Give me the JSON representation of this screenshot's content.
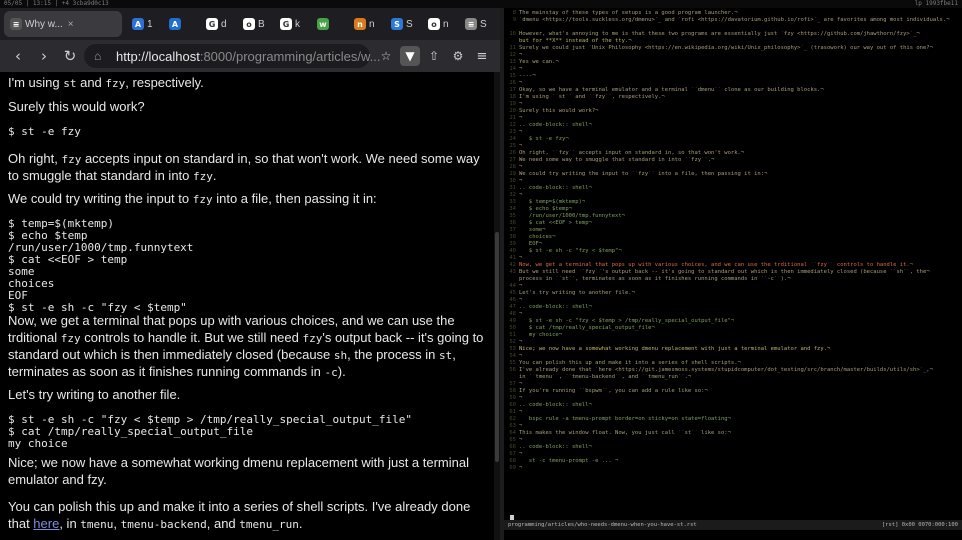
{
  "statusbar": {
    "left": "05/05 | 13:15 | +4 3cba9d0c13",
    "right": "lp 1993fbe11"
  },
  "tabs": [
    {
      "label": "1",
      "favicon": "A",
      "color": "#2f6fd8",
      "active": false
    },
    {
      "label": "",
      "favicon": "A",
      "color": "#1f6fd1",
      "active": false
    },
    {
      "label": "d",
      "favicon": "G",
      "color": "#ffffff",
      "active": false
    },
    {
      "label": "B",
      "favicon": "o",
      "color": "#ffffff",
      "active": false
    },
    {
      "label": "k",
      "favicon": "G",
      "color": "#ffffff",
      "active": false
    },
    {
      "label": "",
      "favicon": "w",
      "color": "#45a545",
      "active": false
    },
    {
      "label": "n",
      "favicon": "n",
      "color": "#d97a1d",
      "active": false
    },
    {
      "label": "S",
      "favicon": "S",
      "color": "#2b7bd6",
      "active": false
    },
    {
      "label": "n",
      "favicon": "o",
      "color": "#ffffff",
      "active": false
    },
    {
      "label": "S",
      "favicon": "≡",
      "color": "#888888",
      "active": false
    }
  ],
  "active_tab": {
    "title": "Why w...",
    "close": "×"
  },
  "nav": {
    "url_host": "http://localhost",
    "url_path": ":8000/programming/articles/w...",
    "back": "‹",
    "forward": "›",
    "reload": "↻",
    "star": "☆",
    "shield": "▼",
    "share": "⇧",
    "ext": "⚙",
    "menu": "≡"
  },
  "article": {
    "p0": "I'm using st and fzy, respectively.",
    "p1": "Surely this would work?",
    "c1": "$ st -e fzy",
    "p2a": "Oh right, ",
    "p2code": "fzy",
    "p2b": " accepts input on standard in, so that won't work. We need some way to smuggle that standard in into ",
    "p2code2": "fzy",
    "p2c": ".",
    "p3a": "We could try writing the input to ",
    "p3code": "fzy",
    "p3b": " into a file, then passing it in:",
    "c2": "$ temp=$(mktemp)\n$ echo $temp\n/run/user/1000/tmp.funnytext\n$ cat <<EOF > temp\nsome\nchoices\nEOF\n$ st -e sh -c \"fzy < $temp\"",
    "p4a": "Now, we get a terminal that pops up with various choices, and we can use the trditional ",
    "p4code": "fzy",
    "p4b": " controls to handle it. But we still need ",
    "p4code2": "fzy",
    "p4c": "'s output back -- it's going to standard out which is then immediately closed (because ",
    "p4code3": "sh",
    "p4d": ", the process in ",
    "p4code4": "st",
    "p4e": ", terminates as soon as it finishes running commands in ",
    "p4code5": "-c",
    "p4f": ").",
    "p5": "Let's try writing to another file.",
    "c3": "$ st -e sh -c \"fzy < $temp > /tmp/really_special_output_file\"\n$ cat /tmp/really_special_output_file\nmy choice",
    "p6": "Nice; we now have a somewhat working dmenu replacement with just a terminal emulator and fzy.",
    "p7a": "You can polish this up and make it into a series of shell scripts. I've already done that ",
    "p7link": "here",
    "p7b": ", in ",
    "p7code": "tmenu",
    "p7c": ", ",
    "p7code2": "tmenu-backend",
    "p7d": ", and ",
    "p7code3": "tmenu_run",
    "p7e": "."
  },
  "editor_lines": [
    {
      "n": "8",
      "t": "The mainstay of these types of setups is a good program launcher.¬",
      "c": ""
    },
    {
      "n": "9",
      "t": "`dmenu <https://tools.suckless.org/dmenu>`_ and `rofi <https://davatorium.github.io/rofi>`_ are favorites among most individuals.¬",
      "c": ""
    },
    {
      "n": "",
      "t": "",
      "c": ""
    },
    {
      "n": "10",
      "t": "However, what's annoying to me is that these two programs are essentially just `fzy <https://github.com/jhawthorn/fzy>`_¬",
      "c": ""
    },
    {
      "n": "",
      "t": "but for **X** instead of the tty.¬",
      "c": "em"
    },
    {
      "n": "11",
      "t": "Surely we could just `Unix Philosophy <https://en.wikipedia.org/wiki/Unix_philosophy>`_ (trasowork) our way out of this one?¬",
      "c": ""
    },
    {
      "n": "12",
      "t": "¬",
      "c": ""
    },
    {
      "n": "13",
      "t": "Yes we can.¬",
      "c": ""
    },
    {
      "n": "14",
      "t": "¬",
      "c": ""
    },
    {
      "n": "15",
      "t": "----¬",
      "c": ""
    },
    {
      "n": "16",
      "t": "¬",
      "c": ""
    },
    {
      "n": "17",
      "t": "Okay, so we have a terminal emulator and a terminal ``dmenu`` clone as our building blocks.¬",
      "c": ""
    },
    {
      "n": "18",
      "t": "I'm using ``st`` and ``fzy``, respectively.¬",
      "c": ""
    },
    {
      "n": "19",
      "t": "¬",
      "c": ""
    },
    {
      "n": "20",
      "t": "Surely this would work?¬",
      "c": ""
    },
    {
      "n": "21",
      "t": "¬",
      "c": ""
    },
    {
      "n": "22",
      "t": ".. code-block:: shell¬",
      "c": "blk"
    },
    {
      "n": "23",
      "t": "¬",
      "c": ""
    },
    {
      "n": "24",
      "t": "   $ st -e fzy¬",
      "c": "blk"
    },
    {
      "n": "25",
      "t": "¬",
      "c": ""
    },
    {
      "n": "26",
      "t": "Oh right, ``fzy`` accepts input on standard in, so that won't work.¬",
      "c": ""
    },
    {
      "n": "27",
      "t": "We need some way to smuggle that standard in into ``fzy``.¬",
      "c": ""
    },
    {
      "n": "28",
      "t": "¬",
      "c": ""
    },
    {
      "n": "29",
      "t": "We could try writing the input to ``fzy`` into a file, then passing it in:¬",
      "c": ""
    },
    {
      "n": "30",
      "t": "¬",
      "c": ""
    },
    {
      "n": "31",
      "t": ".. code-block:: shell¬",
      "c": "blk"
    },
    {
      "n": "32",
      "t": "¬",
      "c": ""
    },
    {
      "n": "33",
      "t": "   $ temp=$(mktemp)¬",
      "c": "blk"
    },
    {
      "n": "34",
      "t": "   $ echo $temp¬",
      "c": "blk"
    },
    {
      "n": "35",
      "t": "   /run/user/1000/tmp.funnytext¬",
      "c": "blk"
    },
    {
      "n": "36",
      "t": "   $ cat <<EOF > temp¬",
      "c": "blk"
    },
    {
      "n": "37",
      "t": "   some¬",
      "c": "blk"
    },
    {
      "n": "38",
      "t": "   choices¬",
      "c": "blk"
    },
    {
      "n": "39",
      "t": "   EOF¬",
      "c": "blk"
    },
    {
      "n": "40",
      "t": "   $ st -e sh -c \"fzy < $temp\"¬",
      "c": "blk"
    },
    {
      "n": "41",
      "t": "¬",
      "c": ""
    },
    {
      "n": "42",
      "t": "Now, we get a terminal that pops up with various choices, and we can use the trditional ``fzy`` controls to handle it.¬",
      "c": "hl"
    },
    {
      "n": "43",
      "t": "But we still need ``fzy``'s output back -- it's going to standard out which is then immediately closed (because ``sh``, the¬",
      "c": ""
    },
    {
      "n": "",
      "t": "process in ``st``, terminates as soon as it finishes running commands in ``-c``).¬",
      "c": ""
    },
    {
      "n": "44",
      "t": "¬",
      "c": ""
    },
    {
      "n": "45",
      "t": "Let's try writing to another file.¬",
      "c": ""
    },
    {
      "n": "46",
      "t": "¬",
      "c": ""
    },
    {
      "n": "47",
      "t": ".. code-block:: shell¬",
      "c": "blk"
    },
    {
      "n": "48",
      "t": "¬",
      "c": ""
    },
    {
      "n": "49",
      "t": "   $ st -e sh -c \"fzy < $temp > /tmp/really_special_output_file\"¬",
      "c": "blk"
    },
    {
      "n": "50",
      "t": "   $ cat /tmp/really_special_output_file¬",
      "c": "blk"
    },
    {
      "n": "51",
      "t": "   my choice¬",
      "c": "blk"
    },
    {
      "n": "52",
      "t": "¬",
      "c": ""
    },
    {
      "n": "53",
      "t": "Nice; we now have a somewhat working dmenu replacement with just a terminal emulator and fzy.¬",
      "c": "em"
    },
    {
      "n": "54",
      "t": "¬",
      "c": ""
    },
    {
      "n": "55",
      "t": "You can polish this up and make it into a series of shell scripts.¬",
      "c": ""
    },
    {
      "n": "56",
      "t": "I've already done that `here <https://git.jamesmoss.systems/stupidcomputer/dot_testing/src/branch/master/builds/utils/sh>`_,¬",
      "c": ""
    },
    {
      "n": "",
      "t": "in ``tmenu``, ``tmenu-backend``, and ``tmenu_run``.¬",
      "c": ""
    },
    {
      "n": "57",
      "t": "¬",
      "c": ""
    },
    {
      "n": "58",
      "t": "If you're running ``bspwm``, you can add a rule like so:¬",
      "c": ""
    },
    {
      "n": "59",
      "t": "¬",
      "c": ""
    },
    {
      "n": "60",
      "t": ".. code-block:: shell¬",
      "c": "blk"
    },
    {
      "n": "61",
      "t": "¬",
      "c": ""
    },
    {
      "n": "62",
      "t": "   bspc rule -a tmenu-prompt border=on sticky=on state=floating¬",
      "c": "blk"
    },
    {
      "n": "63",
      "t": "¬",
      "c": ""
    },
    {
      "n": "64",
      "t": "This makes the window float. Now, you just call ``st`` like so:¬",
      "c": ""
    },
    {
      "n": "65",
      "t": "¬",
      "c": ""
    },
    {
      "n": "66",
      "t": ".. code-block:: shell¬",
      "c": "blk"
    },
    {
      "n": "67",
      "t": "¬",
      "c": ""
    },
    {
      "n": "68",
      "t": "   st -c tmenu-prompt -e ... ¬",
      "c": "blk"
    },
    {
      "n": "69",
      "t": "¬",
      "c": ""
    }
  ],
  "modeline": {
    "left": "programming/articles/who-needs-dmenu-when-you-have-st.rst",
    "right": "[rst]  0x00  0070:000:100"
  }
}
